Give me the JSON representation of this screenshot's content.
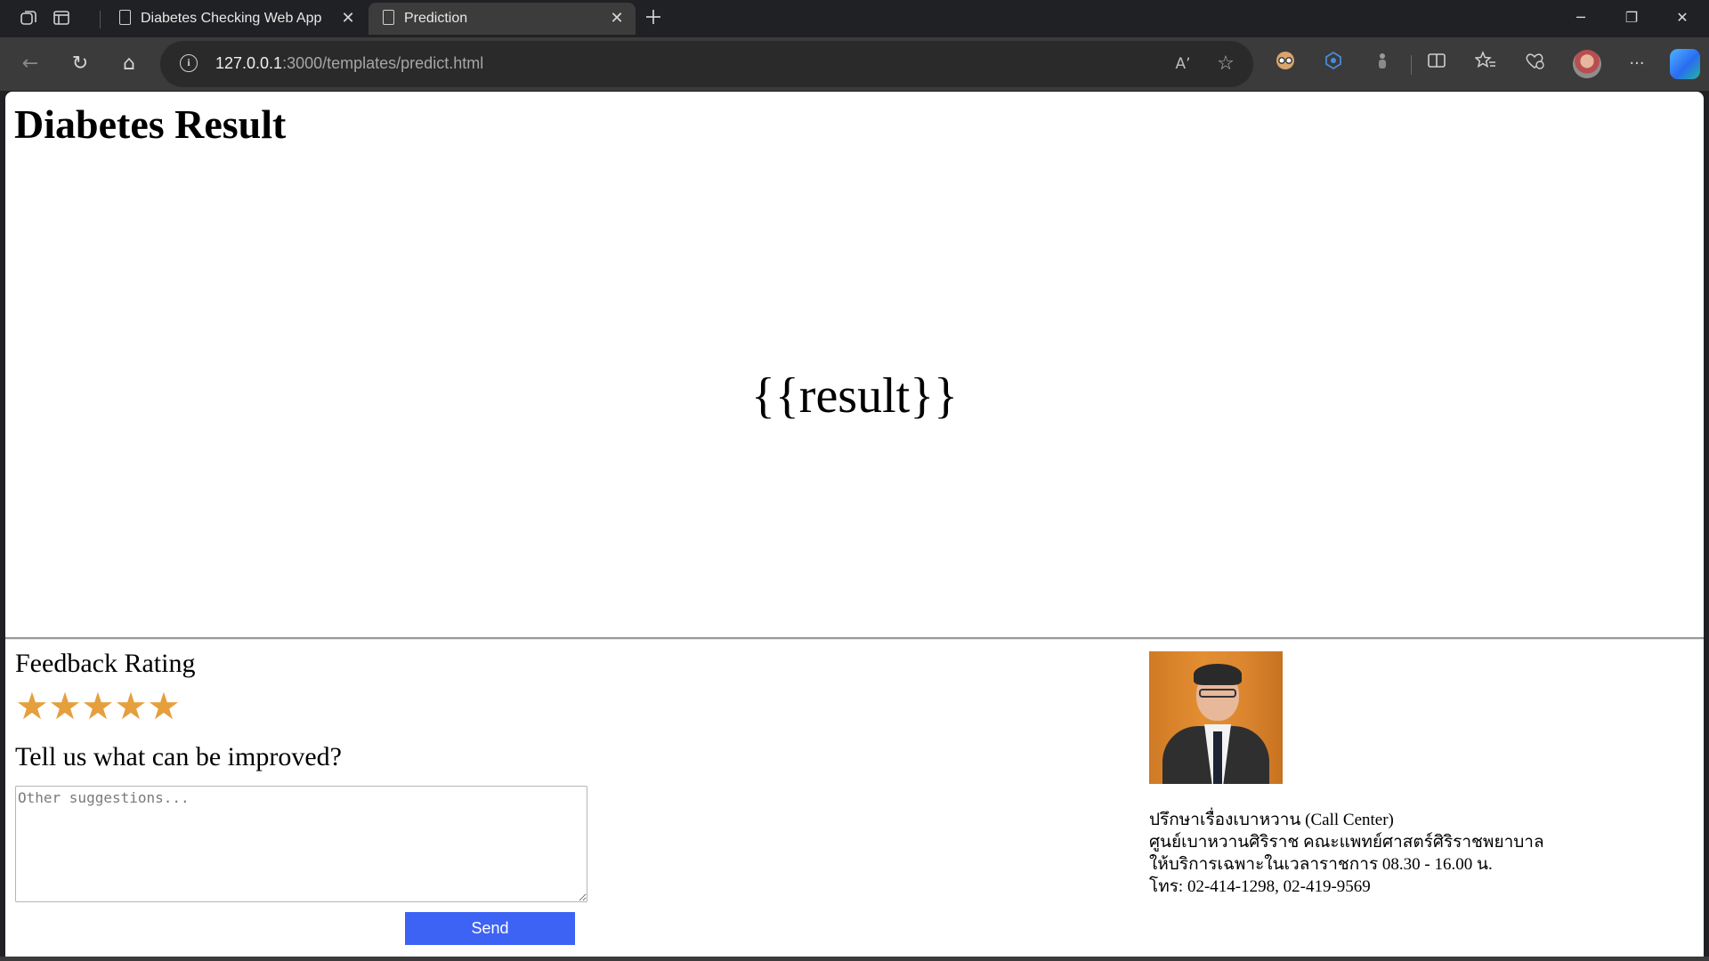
{
  "browser": {
    "tabs": [
      {
        "title": "Diabetes Checking Web App",
        "active": false
      },
      {
        "title": "Prediction",
        "active": true
      }
    ],
    "new_tab_icon": "plus-icon",
    "window_controls": {
      "minimize": "─",
      "restore": "❐",
      "close": "✕"
    },
    "url": {
      "host": "127.0.0.1",
      "rest": ":3000/templates/predict.html"
    },
    "icons": {
      "back": "←",
      "reload": "↻",
      "home": "⌂",
      "read_aloud": "Aʼ",
      "favorite": "☆",
      "more": "···"
    }
  },
  "page": {
    "title": "Diabetes Result",
    "result": "{{result}}",
    "feedback": {
      "heading": "Feedback Rating",
      "rating_max": 5,
      "star_glyph": "★",
      "improve_heading": "Tell us what can be improved?",
      "textarea_placeholder": "Other suggestions...",
      "send_label": "Send"
    },
    "contact": {
      "line1": "ปรึกษาเรื่องเบาหวาน (Call Center)",
      "line2": "ศูนย์เบาหวานศิริราช คณะแพทย์ศาสตร์ศิริราชพยาบาล",
      "line3": "ให้บริการเฉพาะในเวลาราชการ 08.30 - 16.00 น.",
      "line4": "โทร: 02-414-1298, 02-419-9569"
    }
  },
  "colors": {
    "star": "#e59f3d",
    "send_button": "#3d63f5",
    "toolbar": "#3b3b3b",
    "tabbar": "#202124"
  }
}
